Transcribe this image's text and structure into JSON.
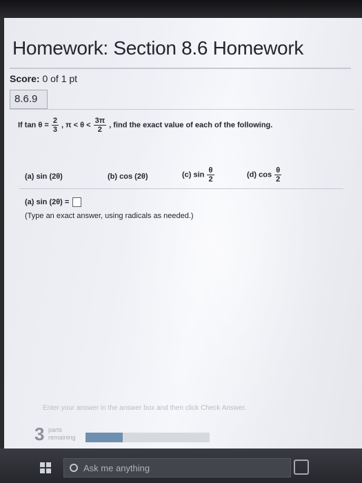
{
  "header": {
    "title": "Homework: Section 8.6 Homework"
  },
  "score": {
    "label": "Score:",
    "value": "0 of 1 pt"
  },
  "question": {
    "number": "8.6.9"
  },
  "problem": {
    "prefix": "If tan θ =",
    "frac1_num": "2",
    "frac1_den": "3",
    "mid": ", π < θ <",
    "frac2_num": "3π",
    "frac2_den": "2",
    "suffix": ", find the exact value of each of the following."
  },
  "parts": [
    {
      "label": "(a) sin (2θ)"
    },
    {
      "label": "(b) cos (2θ)"
    },
    {
      "label": "(c) sin",
      "frac_num": "θ",
      "frac_den": "2"
    },
    {
      "label": "(d) cos",
      "frac_num": "θ",
      "frac_den": "2"
    }
  ],
  "answer": {
    "label": "(a)  sin (2θ) =",
    "instruction": "(Type an exact answer, using radicals as needed.)"
  },
  "footer": {
    "hint": "Enter your answer in the answer box and then click Check Answer.",
    "parts_count": "3",
    "parts_text_1": "parts",
    "parts_text_2": "remaining",
    "progress_fraction": 0.3
  },
  "taskbar": {
    "search_placeholder": "Ask me anything"
  },
  "colors": {
    "accent": "#6f8fb0",
    "text": "#22252b"
  }
}
